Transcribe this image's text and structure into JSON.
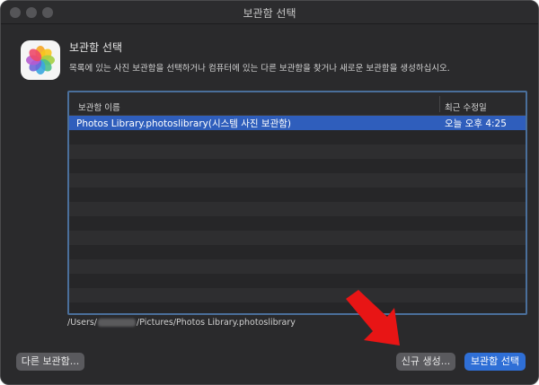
{
  "window": {
    "title": "보관함 선택"
  },
  "header": {
    "title": "보관함 선택",
    "description": "목록에 있는 사진 보관함을 선택하거나 컴퓨터에 있는 다른 보관함을 찾거나 새로운 보관함을 생성하십시오."
  },
  "table": {
    "columns": [
      "보관함 이름",
      "최근 수정일"
    ],
    "rows": [
      {
        "name": "Photos Library.photoslibrary(시스템 사진 보관함)",
        "modified": "오늘 오후 4:25",
        "selected": true
      }
    ],
    "empty_rows": 14
  },
  "path": {
    "prefix": "/Users/",
    "suffix": "/Pictures/Photos Library.photoslibrary"
  },
  "buttons": {
    "other_library": "다른 보관함...",
    "create_new": "신규 생성...",
    "choose_library": "보관함 선택"
  },
  "colors": {
    "accent": "#2f5ebc",
    "primary_button": "#2f6fd6",
    "arrow": "#e81515"
  }
}
